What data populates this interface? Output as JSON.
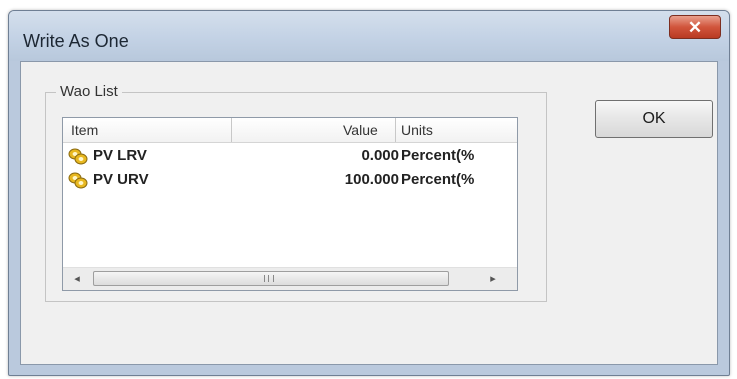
{
  "window": {
    "title": "Write As One",
    "close_glyph": "✕"
  },
  "group": {
    "label": "Wao List"
  },
  "list": {
    "columns": [
      "Item",
      "Value",
      "Units"
    ],
    "rows": [
      {
        "icon": "parameter-icon",
        "item": "PV LRV",
        "value": "0.000",
        "units": "Percent(%"
      },
      {
        "icon": "parameter-icon",
        "item": "PV URV",
        "value": "100.000",
        "units": "Percent(%"
      }
    ]
  },
  "scrollbar": {
    "left_arrow": "◂",
    "right_arrow": "▸"
  },
  "buttons": {
    "ok_label": "OK"
  },
  "colors": {
    "window_frame": "#bac9dd",
    "close_button": "#d1553c",
    "client_bg": "#f0f0f0",
    "icon_yellow": "#e8b820"
  }
}
